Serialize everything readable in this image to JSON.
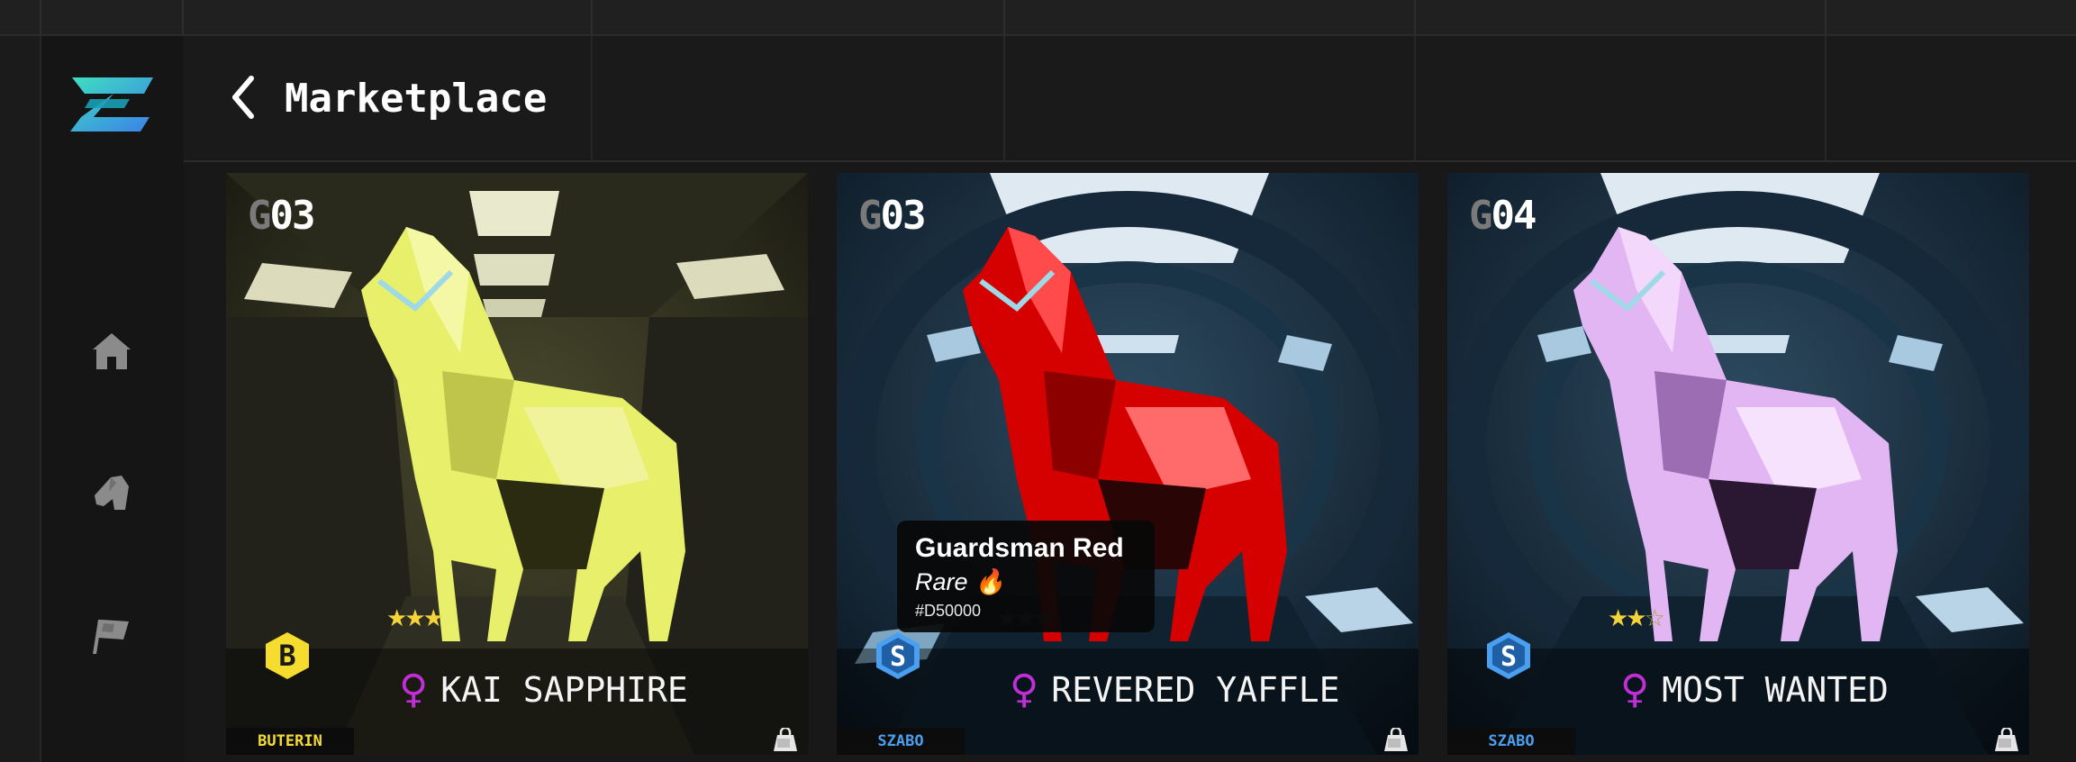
{
  "app": {
    "title": "Marketplace"
  },
  "colors": {
    "accent_teal": "#3fd6b0",
    "accent_blue": "#3fa0f0",
    "buterin_yellow": "#f5dc2e",
    "szabo_blue": "#4a9ff0",
    "gender_female": "#c02fd6",
    "star_gold": "#f5d33a"
  },
  "sidebar": {
    "logo": "zed-logo",
    "items": [
      {
        "icon": "home-icon"
      },
      {
        "icon": "horse-head-icon"
      },
      {
        "icon": "flag-icon"
      }
    ]
  },
  "header": {
    "back_icon": "chevron-left-icon",
    "title": "Marketplace"
  },
  "tooltip": {
    "title": "Guardsman Red",
    "rarity": "Rare 🔥",
    "code": "#D50000"
  },
  "cards": [
    {
      "gen_prefix": "G",
      "gen_number": "03",
      "stars": 3,
      "name": "KAI SAPPHIRE",
      "gender_icon": "♀",
      "bloodline_badge": "B",
      "bloodline": "BUTERIN",
      "bag_icon": "shopping-bag-icon",
      "horse_color": "#e8ef6a"
    },
    {
      "gen_prefix": "G",
      "gen_number": "03",
      "stars": 2.5,
      "name": "REVERED YAFFLE",
      "gender_icon": "♀",
      "bloodline_badge": "S",
      "bloodline": "SZABO",
      "bag_icon": "shopping-bag-icon",
      "horse_color": "#d50000"
    },
    {
      "gen_prefix": "G",
      "gen_number": "04",
      "stars": 2.5,
      "name": "MOST WANTED",
      "gender_icon": "♀",
      "bloodline_badge": "S",
      "bloodline": "SZABO",
      "bag_icon": "shopping-bag-icon",
      "horse_color": "#e2b6f2"
    }
  ]
}
